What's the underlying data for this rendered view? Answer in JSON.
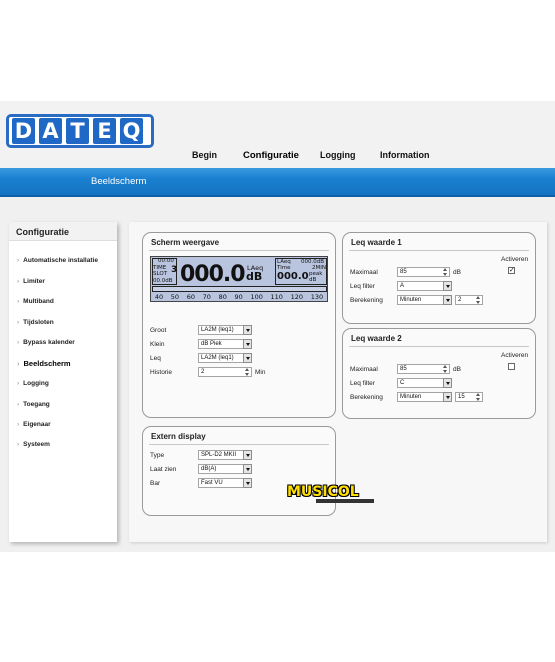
{
  "brand": {
    "logo_letters": [
      "D",
      "A",
      "T",
      "E",
      "Q"
    ],
    "accent": "#1f68c6"
  },
  "topnav": {
    "begin": "Begin",
    "configuratie": "Configuratie",
    "logging": "Logging",
    "information": "Information"
  },
  "subheader": "Beeldscherm",
  "sidebar": {
    "title": "Configuratie",
    "items": [
      {
        "label": "Automatische installatie"
      },
      {
        "label": "Limiter"
      },
      {
        "label": "Multiband"
      },
      {
        "label": "Tijdsloten"
      },
      {
        "label": "Bypass kalender"
      },
      {
        "label": "Beeldscherm",
        "active": true
      },
      {
        "label": "Logging"
      },
      {
        "label": "Toegang"
      },
      {
        "label": "Eigenaar"
      },
      {
        "label": "Systeem"
      }
    ]
  },
  "scherm": {
    "title": "Scherm weergave",
    "lcd": {
      "time": "00:00",
      "time_label": "TIME",
      "slot_label": "SLOT",
      "slot": "3",
      "db_small": "00.0dB",
      "main_value": "000.0",
      "main_unit": "dB",
      "laeq_label": "LAeq",
      "laeq_box": "LAeq",
      "laeq_value": "000.0dB",
      "time_box": "Time",
      "time_box_value": "2MIN",
      "peak_value": "000.0",
      "peak_label": "peak",
      "peak_unit": "dB",
      "scale": [
        "40",
        "50",
        "60",
        "70",
        "80",
        "90",
        "100",
        "110",
        "120",
        "130"
      ]
    },
    "fields": {
      "groot_label": "Groot",
      "groot_value": "LA2M (leq1)",
      "klein_label": "Klein",
      "klein_value": "dB Piek",
      "leq_label": "Leq",
      "leq_value": "LA2M (leq1)",
      "historie_label": "Historie",
      "historie_value": "2",
      "historie_unit": "Min"
    }
  },
  "leq1": {
    "title": "Leq waarde 1",
    "activeren_label": "Activeren",
    "activeren_checked": true,
    "maximaal_label": "Maximaal",
    "maximaal_value": "85",
    "maximaal_unit": "dB",
    "filter_label": "Leq filter",
    "filter_value": "A",
    "berekening_label": "Berekening",
    "berekening_value": "Minuten",
    "berekening_num": "2"
  },
  "leq2": {
    "title": "Leq waarde 2",
    "activeren_label": "Activeren",
    "activeren_checked": false,
    "maximaal_label": "Maximaal",
    "maximaal_value": "85",
    "maximaal_unit": "dB",
    "filter_label": "Leq filter",
    "filter_value": "C",
    "berekening_label": "Berekening",
    "berekening_value": "Minuten",
    "berekening_num": "15"
  },
  "extern": {
    "title": "Extern display",
    "type_label": "Type",
    "type_value": "SPL-D2 MKII",
    "laat_label": "Laat zien",
    "laat_value": "dB(A)",
    "bar_label": "Bar",
    "bar_value": "Fast VU"
  },
  "watermark": {
    "text": "MUSICOL"
  }
}
